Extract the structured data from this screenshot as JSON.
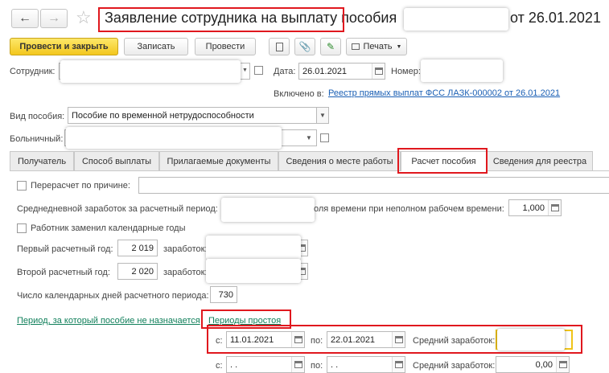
{
  "window": {
    "title": "Заявление сотрудника на выплату пособия",
    "title_suffix": "от 26.01.2021"
  },
  "toolbar": {
    "post_close_label": "Провести и закрыть",
    "write_label": "Записать",
    "post_label": "Провести",
    "print_label": "Печать"
  },
  "header": {
    "employee_label": "Сотрудник:",
    "employee_value": "",
    "date_label": "Дата:",
    "date_value": "26.01.2021",
    "number_label": "Номер:",
    "number_value": "",
    "included_label": "Включено в:",
    "included_link": "Реестр прямых выплат ФСС ЛАЗК-000002 от 26.01.2021",
    "benefit_type_label": "Вид пособия:",
    "benefit_type_value": "Пособие по временной нетрудоспособности",
    "sick_leave_label": "Больничный:",
    "sick_leave_value": ""
  },
  "tabs": [
    {
      "label": "Получатель"
    },
    {
      "label": "Способ выплаты"
    },
    {
      "label": "Прилагаемые документы"
    },
    {
      "label": "Сведения о месте работы"
    },
    {
      "label": "Расчет пособия"
    },
    {
      "label": "Сведения для реестра"
    }
  ],
  "calc": {
    "recalc_label": "Перерасчет по причине:",
    "recalc_value": "",
    "avg_earnings_label": "Среднедневной заработок за расчетный период:",
    "avg_earnings_value": "",
    "part_time_label": "оля времени при неполном рабочем времени:",
    "part_time_value": "1,000",
    "replaced_years_label": "Работник заменил календарные годы",
    "first_year_label": "Первый расчетный год:",
    "first_year_value": "2 019",
    "earnings_label": "заработок:",
    "first_year_earnings": "",
    "second_year_label": "Второй расчетный год:",
    "second_year_value": "2 020",
    "second_year_earnings": "",
    "days_label": "Число календарных дней расчетного периода:",
    "days_value": "730",
    "link_not_assigned": "Период, за который пособие не назначается",
    "link_downtime": "Периоды простоя"
  },
  "downtime_rows": [
    {
      "from_label": "с:",
      "from": "11.01.2021",
      "to_label": "по:",
      "to": "22.01.2021",
      "avg_label": "Средний заработок:",
      "avg": ""
    },
    {
      "from_label": "с:",
      "from": " .  .",
      "to_label": "по:",
      "to": " .  .",
      "avg_label": "Средний заработок:",
      "avg": "0,00"
    }
  ],
  "colors": {
    "accent_yellow": "#f3c71d",
    "highlight_red": "#e0181e",
    "link_green": "#0f7f5a",
    "link_blue": "#1a5fb4"
  }
}
